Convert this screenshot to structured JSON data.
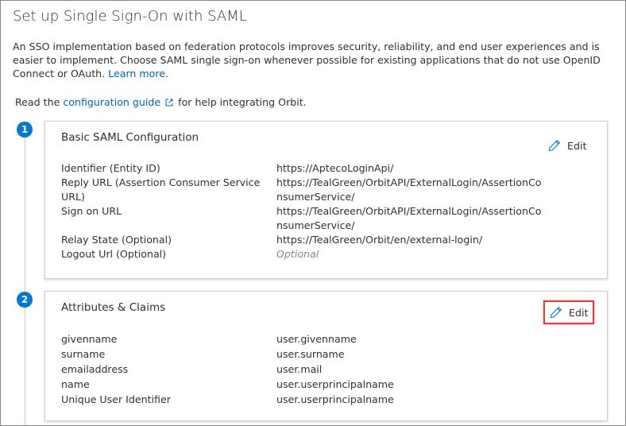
{
  "page": {
    "title": "Set up Single Sign-On with SAML",
    "intro_text": "An SSO implementation based on federation protocols improves security, reliability, and end user experiences and is easier to implement. Choose SAML single sign-on whenever possible for existing applications that do not use OpenID Connect or OAuth.",
    "learn_more": "Learn more.",
    "read_prefix": "Read the",
    "config_guide_link": "configuration guide",
    "read_suffix": "for help integrating Orbit."
  },
  "steps": [
    {
      "number": "1",
      "title": "Basic SAML Configuration",
      "edit_label": "Edit",
      "rows": [
        {
          "key": "Identifier (Entity ID)",
          "value": "https://AptecoLoginApi/"
        },
        {
          "key": "Reply URL (Assertion Consumer Service URL)",
          "value": "https://TealGreen/OrbitAPI/ExternalLogin/AssertionConsumerService/"
        },
        {
          "key": "Sign on URL",
          "value": "https://TealGreen/OrbitAPI/ExternalLogin/AssertionConsumerService/"
        },
        {
          "key": "Relay State (Optional)",
          "value": "https://TealGreen/Orbit/en/external-login/"
        },
        {
          "key": "Logout Url (Optional)",
          "value": "Optional"
        }
      ]
    },
    {
      "number": "2",
      "title": "Attributes & Claims",
      "edit_label": "Edit",
      "rows": [
        {
          "key": "givenname",
          "value": "user.givenname"
        },
        {
          "key": "surname",
          "value": "user.surname"
        },
        {
          "key": "emailaddress",
          "value": "user.mail"
        },
        {
          "key": "name",
          "value": "user.userprincipalname"
        },
        {
          "key": "Unique User Identifier",
          "value": "user.userprincipalname"
        }
      ]
    }
  ],
  "colors": {
    "accent": "#0078d4",
    "link": "#0067b8",
    "highlight": "#e23b3b"
  },
  "icons": {
    "edit": "pencil-icon",
    "external": "external-link-icon"
  }
}
